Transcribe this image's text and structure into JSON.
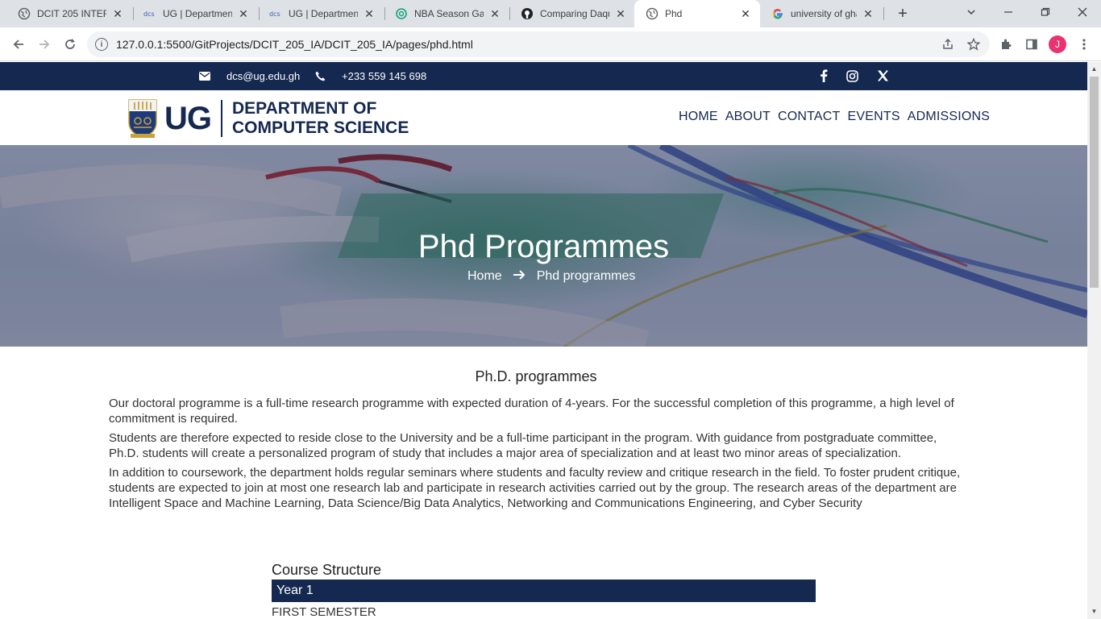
{
  "browser": {
    "tabs": [
      {
        "title": "DCIT 205 INTERI",
        "icon": "globe-icon",
        "active": false
      },
      {
        "title": "UG | Department",
        "icon": "dcs-icon",
        "active": false
      },
      {
        "title": "UG | Department",
        "icon": "dcs-icon",
        "active": false
      },
      {
        "title": "NBA Season Gar",
        "icon": "openai-icon",
        "active": false
      },
      {
        "title": "Comparing Daqu",
        "icon": "github-icon",
        "active": false
      },
      {
        "title": "Phd",
        "icon": "globe-icon",
        "active": true
      },
      {
        "title": "university of gha",
        "icon": "google-icon",
        "active": false
      }
    ],
    "url": "127.0.0.1:5500/GitProjects/DCIT_205_IA/DCIT_205_IA/pages/phd.html",
    "profile_initial": "J"
  },
  "topbar": {
    "email": "dcs@ug.edu.gh",
    "phone": "+233 559 145 698",
    "socials": [
      "facebook-icon",
      "instagram-icon",
      "x-icon"
    ]
  },
  "header": {
    "logo_ug": "UG",
    "logo_line1": "DEPARTMENT OF",
    "logo_line2": "COMPUTER SCIENCE",
    "nav": [
      "HOME",
      "ABOUT",
      "CONTACT",
      "EVENTS",
      "ADMISSIONS"
    ]
  },
  "hero": {
    "title": "Phd Programmes",
    "breadcrumb_home": "Home",
    "breadcrumb_current": "Phd programmes"
  },
  "content": {
    "heading": "Ph.D. programmes",
    "paragraphs": [
      "Our doctoral programme is a full-time research programme with expected duration of 4-years. For the successful completion of this programme, a high level of commitment is required.",
      "Students are therefore expected to reside close to the University and be a full-time participant in the program. With guidance from postgraduate committee, Ph.D. students will create a personalized program of study that includes a major area of specialization and at least two minor areas of specialization.",
      "In addition to coursework, the department holds regular seminars where students and faculty review and critique research in the field. To foster prudent critique, students are expected to join at most one research lab and participate in research activities carried out by the group. The research areas of the department are Intelligent Space and Machine Learning, Data Science/Big Data Analytics, Networking and Communications Engineering, and Cyber Security"
    ]
  },
  "course": {
    "title": "Course Structure",
    "year": "Year 1",
    "semester": "FIRST SEMESTER"
  },
  "colors": {
    "navy": "#152850",
    "profile": "#e8336e"
  }
}
